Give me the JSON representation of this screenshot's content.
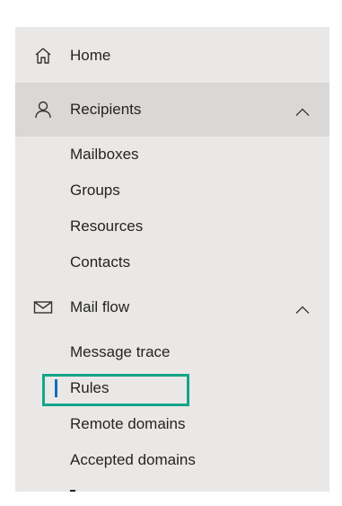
{
  "nav": {
    "home": {
      "label": "Home",
      "icon": "home-icon"
    },
    "recipients": {
      "label": "Recipients",
      "icon": "person-icon",
      "expanded": true,
      "items": [
        "Mailboxes",
        "Groups",
        "Resources",
        "Contacts"
      ]
    },
    "mail_flow": {
      "label": "Mail flow",
      "icon": "mail-icon",
      "expanded": true,
      "items": [
        "Message trace",
        "Rules",
        "Remote domains",
        "Accepted domains"
      ]
    },
    "selected_item": "Rules"
  },
  "colors": {
    "nav_background": "#e9e8e6",
    "active_row_background": "#d9d8d6",
    "selection_indicator": "#0f6cbd",
    "highlight_box": "#13a58a"
  }
}
